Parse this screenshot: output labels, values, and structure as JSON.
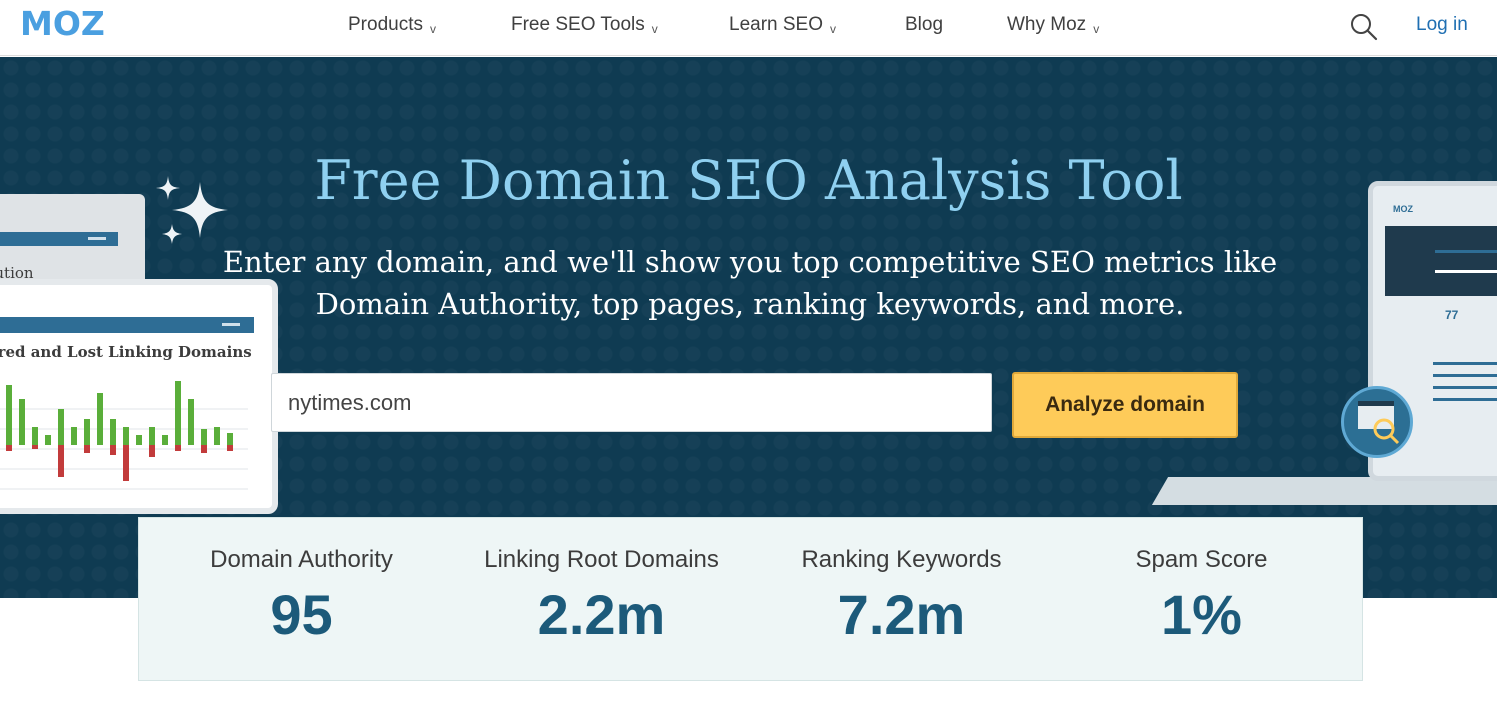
{
  "brand": {
    "logo_text": "MOZ",
    "accent": "#4a9fe0"
  },
  "nav": {
    "items": [
      {
        "label": "Products",
        "has_dropdown": true
      },
      {
        "label": "Free SEO Tools",
        "has_dropdown": true
      },
      {
        "label": "Learn SEO",
        "has_dropdown": true
      },
      {
        "label": "Blog",
        "has_dropdown": false
      },
      {
        "label": "Why Moz",
        "has_dropdown": true
      }
    ],
    "dropdown_glyph": "v",
    "search_icon": "search-icon",
    "login_label": "Log in"
  },
  "hero": {
    "title": "Free Domain SEO Analysis Tool",
    "subtitle": "Enter any domain, and we'll show you top competitive SEO metrics like Domain Authority, top pages, ranking keywords, and more.",
    "search": {
      "value": "nytimes.com",
      "placeholder": ""
    },
    "analyze_button_label": "Analyze domain",
    "background_color": "#0f3b52",
    "title_color": "#8fd0f0",
    "button_color": "#fecb59"
  },
  "illustration": {
    "back_card_text": "ibution",
    "front_card_text": "ered and Lost Linking Domains",
    "laptop_logo": "MOZ",
    "laptop_number": "77",
    "chart_gain_color": "#5aae3a",
    "chart_loss_color": "#c23b3b"
  },
  "metrics": [
    {
      "label": "Domain Authority",
      "value": "95"
    },
    {
      "label": "Linking Root Domains",
      "value": "2.2m"
    },
    {
      "label": "Ranking Keywords",
      "value": "7.2m"
    },
    {
      "label": "Spam Score",
      "value": "1%"
    }
  ]
}
